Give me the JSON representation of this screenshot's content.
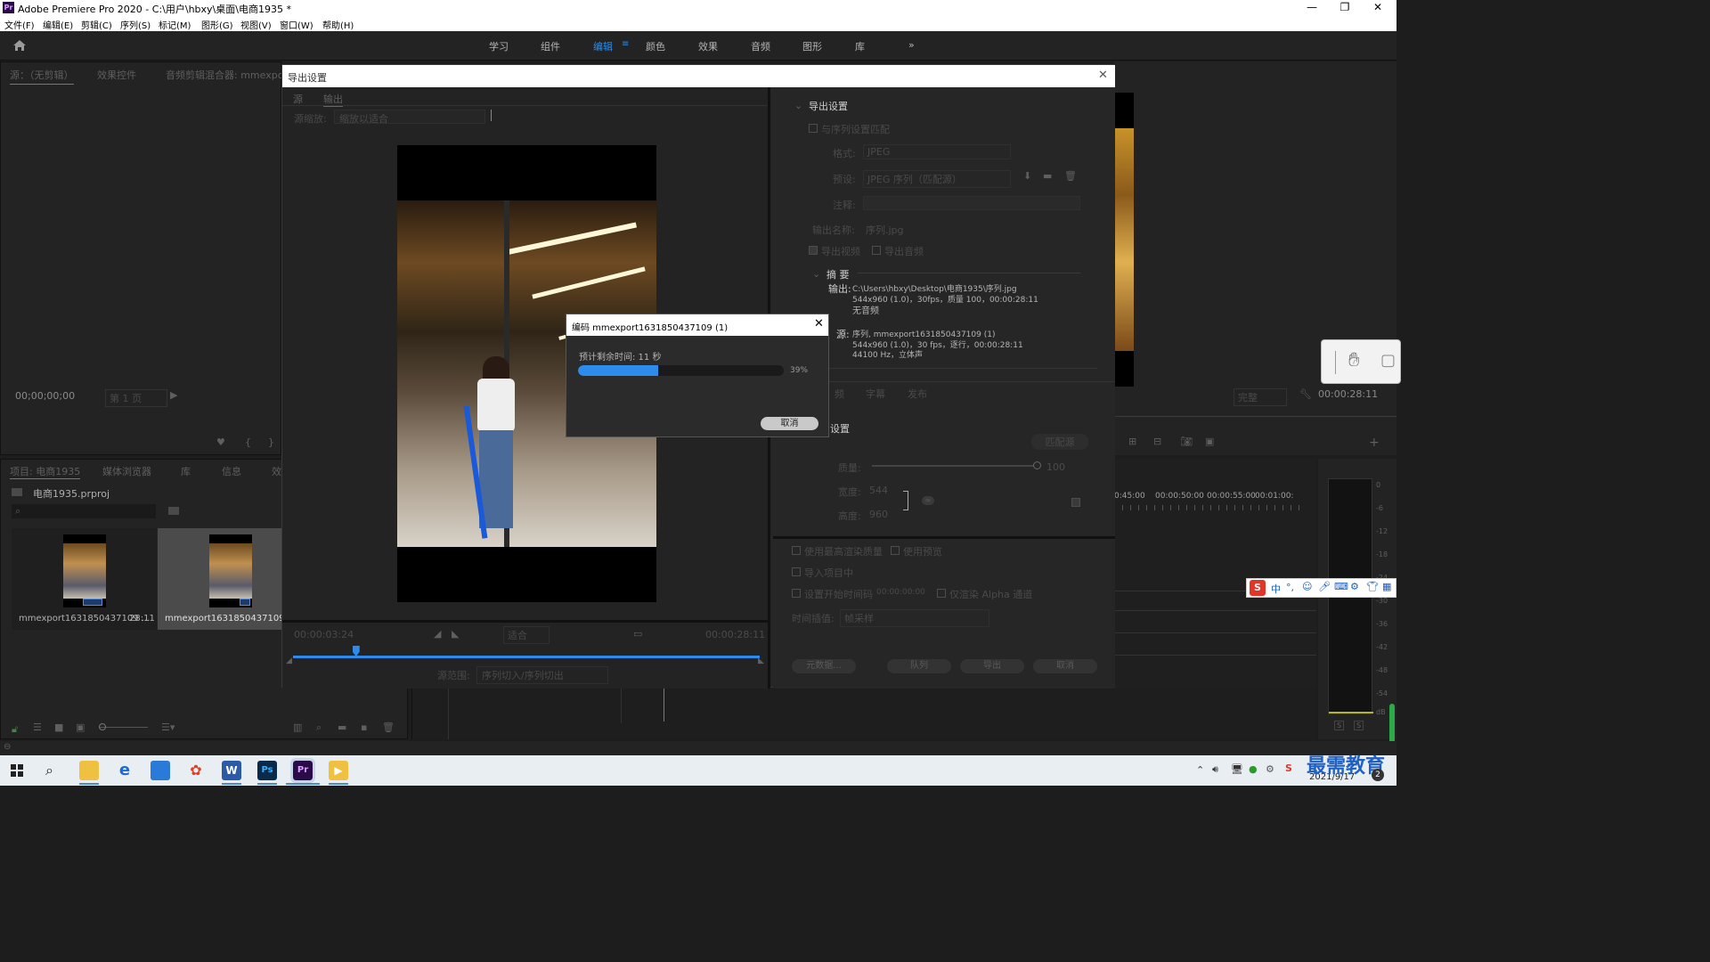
{
  "window": {
    "app_icon": "Pr",
    "title": "Adobe Premiere Pro 2020 - C:\\用户\\hbxy\\桌面\\电商1935 *",
    "controls": [
      "minimize",
      "maximize",
      "close"
    ]
  },
  "menu": [
    "文件(F)",
    "编辑(E)",
    "剪辑(C)",
    "序列(S)",
    "标记(M)",
    "图形(G)",
    "视图(V)",
    "窗口(W)",
    "帮助(H)"
  ],
  "workspaces": {
    "items": [
      "学习",
      "组件",
      "编辑",
      "颜色",
      "效果",
      "音频",
      "图形",
      "库"
    ],
    "active": "编辑",
    "more": "»"
  },
  "source_panel": {
    "tabs": [
      "源：（无剪辑）",
      "效果控件",
      "音频剪辑混合器: mmexport1"
    ],
    "timecode": "00;00;00;00",
    "page": "第 1 页"
  },
  "project_panel": {
    "tabs": [
      "项目: 电商1935",
      "媒体浏览器",
      "库",
      "信息",
      "效"
    ],
    "project_file": "电商1935.prproj",
    "items": [
      {
        "name": "mmexport1631850437109 ...",
        "duration": "28:11"
      },
      {
        "name": "mmexport1631850437109 (1)",
        "duration": "28:11"
      }
    ]
  },
  "program_panel": {
    "timecode": "00:00:28:11",
    "fit": "完整"
  },
  "timeline": {
    "ruler": [
      "0:45:00",
      "00:00:50:00",
      "00:00:55:00",
      "00:01:00:"
    ]
  },
  "audio_meter": {
    "scale": [
      "0",
      "-6",
      "-12",
      "-18",
      "-24",
      "-30",
      "-36",
      "-42",
      "-48",
      "-54",
      "dB"
    ],
    "solo": [
      "S",
      "S"
    ]
  },
  "export_dialog": {
    "title": "导出设置",
    "tabs": [
      "源",
      "输出"
    ],
    "source_scaling_label": "源缩放:",
    "source_scaling_value": "缩放以适合",
    "current_time": "00:00:03:24",
    "fit_label": "适合",
    "end_time": "00:00:28:11",
    "range_label": "源范围:",
    "range_value": "序列切入/序列切出",
    "playhead_fraction": 0.135,
    "settings": {
      "header": "导出设置",
      "match_sequence": "与序列设置匹配",
      "format_label": "格式:",
      "format_value": "JPEG",
      "preset_label": "预设:",
      "preset_value": "JPEG 序列（匹配源）",
      "comment_label": "注释:",
      "output_name_label": "输出名称:",
      "output_name_value": "序列.jpg",
      "export_video": "导出视频",
      "export_audio": "导出音频",
      "summary_header": "摘 要",
      "output_label": "输出:",
      "output_lines": [
        "C:\\Users\\hbxy\\Desktop\\电商1935\\序列.jpg",
        "544x960 (1.0)，30fps，质量 100，00:00:28:11",
        "无音频"
      ],
      "source_label": "源:",
      "source_lines": [
        "序列, mmexport1631850437109 (1)",
        "544x960 (1.0)，30 fps，逐行，00:00:28:11",
        "44100 Hz，立体声"
      ]
    },
    "sub_tabs": [
      "频",
      "字幕",
      "发布"
    ],
    "video_section": "设置",
    "match_source_btn": "匹配源",
    "quality_label": "质量:",
    "quality_value": "100",
    "quality_fraction": 1.0,
    "width_label": "宽度:",
    "width_value": "544",
    "height_label": "高度:",
    "height_value": "960",
    "options": {
      "max_render": "使用最高渲染质量",
      "use_previews": "使用预览",
      "import_project": "导入项目中",
      "set_start_tc": "设置开始时间码",
      "start_tc_value": "00:00:00:00",
      "alpha_only": "仅渲染 Alpha 通道",
      "interp_label": "时间插值:",
      "interp_value": "帧采样"
    },
    "buttons": [
      "元数据...",
      "队列",
      "导出",
      "取消"
    ]
  },
  "encode_dialog": {
    "title": "编码 mmexport1631850437109 (1)",
    "remaining": "预计剩余时间: 11 秒",
    "progress": 0.39,
    "progress_label": "39%",
    "cancel": "取消"
  },
  "ime_toolbar": [
    "S",
    "中",
    "°,",
    "☺",
    "mic",
    "keyboard",
    "shirt",
    "grid"
  ],
  "taskbar": {
    "apps": [
      "start",
      "search",
      "explorer",
      "edge",
      "photos",
      "app",
      "word",
      "photoshop",
      "premiere",
      "media"
    ],
    "date": "2021/9/17",
    "watermark": "最需教育",
    "notification_count": "2"
  },
  "colors": {
    "accent": "#2d8ceb",
    "panel_bg": "#232323",
    "dialog_bg": "#262626"
  }
}
